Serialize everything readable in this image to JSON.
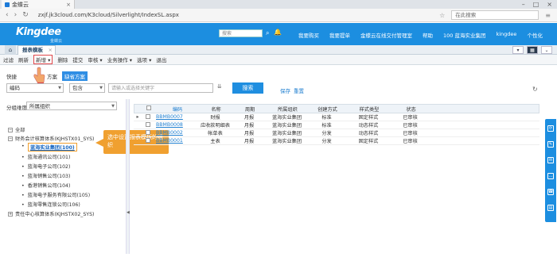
{
  "browser": {
    "tab_title": "金蝶云",
    "url": "zxjf.jk3cloud.com/K3cloud/Silverlight/IndexSL.aspx",
    "search_placeholder": "在此搜索"
  },
  "header": {
    "logo": "Kingdee",
    "logo_sub": "金蝶云",
    "search_placeholder": "搜索",
    "menu": [
      "我要购买",
      "我要提单",
      "金蝶云在线交付管理室",
      "帮助",
      "100  蓝海实业集团",
      "kingdee",
      "个性化"
    ]
  },
  "app_tabs": {
    "home": "⌂",
    "active": "报表模板"
  },
  "toolbar": [
    "过滤",
    "刷新",
    "新增",
    "删除",
    "提交",
    "审核",
    "业务操作",
    "选项",
    "退出"
  ],
  "filter": {
    "quick_label": "快捷",
    "plan_label": "方案",
    "default_scheme": "缺省方案",
    "field": "编码",
    "operator": "包含",
    "value_placeholder": "请输入或选择关键字",
    "search_button": "搜索",
    "save": "保存",
    "reset": "重置"
  },
  "left_panel": {
    "dim_label": "分组维度",
    "dim_value": "所属组织",
    "tree": {
      "root": "全部",
      "group1": "财务会计核算体系(KJHSTX01_SYS)",
      "orgs": [
        "蓝海实业集团(100)",
        "蓝海通讯公司(101)",
        "蓝海电子公司(102)",
        "蓝海销售公司(103)",
        "香港销售公司(104)",
        "蓝海电子服务有限公司(105)",
        "蓝海零售连锁公司(106)"
      ],
      "group2": "责任中心核算体系(KJHSTX02_SYS)"
    }
  },
  "callout": "选中设置报表模板的组织",
  "grid": {
    "columns": [
      "编码",
      "名称",
      "周期",
      "所属组织",
      "创建方式",
      "样式类型",
      "状态"
    ],
    "rows": [
      [
        "BBMB0007",
        "财报",
        "月报",
        "蓝海实业集团",
        "标准",
        "固定样式",
        "已审核"
      ],
      [
        "BBMB0008",
        "应收款明细表",
        "月报",
        "蓝海实业集团",
        "标准",
        "动态样式",
        "已审核"
      ],
      [
        "BBMB0002",
        "帐单表",
        "月报",
        "蓝海实业集团",
        "分发",
        "动态样式",
        "已审核"
      ],
      [
        "BBMB0001",
        "主表",
        "月报",
        "蓝海实业集团",
        "分发",
        "固定样式",
        "已审核"
      ]
    ]
  }
}
